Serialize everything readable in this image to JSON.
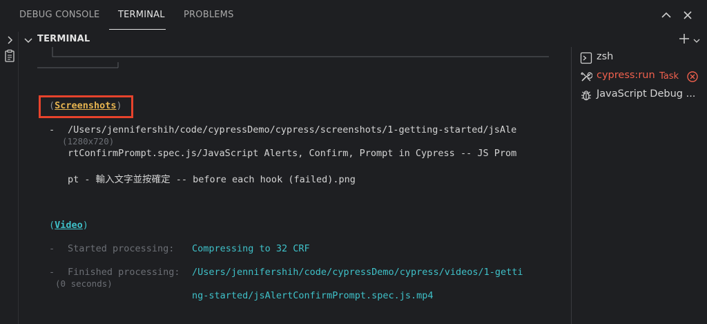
{
  "tabs": {
    "debug_console": "DEBUG CONSOLE",
    "terminal": "TERMINAL",
    "problems": "PROBLEMS"
  },
  "terminal_header": {
    "label": "TERMINAL"
  },
  "terminal_output": {
    "screenshots_heading_open": "(",
    "screenshots_heading_text": "Screenshots",
    "screenshots_heading_close": ")",
    "bullet": "-",
    "screenshot_path_line1": "/Users/jennifershih/code/cypressDemo/cypress/screenshots/1-getting-started/jsAle",
    "screenshot_size": "(1280x720)",
    "screenshot_path_line2": "rtConfirmPrompt.spec.js/JavaScript Alerts, Confirm, Prompt in Cypress -- JS Prom",
    "screenshot_path_line3": "pt - 輸入文字並按確定 -- before each hook (failed).png",
    "video_heading_open": "(",
    "video_heading_text": "Video",
    "video_heading_close": ")",
    "started_label": "Started processing:",
    "started_value": "Compressing to 32 CRF",
    "finished_label": "Finished processing:",
    "finished_value_line1": "/Users/jennifershih/code/cypressDemo/cypress/videos/1-getti",
    "finished_time": "(0 seconds)",
    "finished_value_line2": "ng-started/jsAlertConfirmPrompt.spec.js.mp4"
  },
  "terminal_list": {
    "items": [
      {
        "label": "zsh",
        "icon": "terminal-icon"
      },
      {
        "label": "cypress:run",
        "suffix": "Task",
        "icon": "tools-icon",
        "status_icon": "error-circle-icon"
      },
      {
        "label": "JavaScript Debug ...",
        "icon": "bug-icon"
      }
    ]
  },
  "colors": {
    "background": "#1e1f22",
    "cyan": "#3fc1c9",
    "yellow": "#e6b450",
    "error_red": "#f0604d",
    "highlight_box": "#e7432c"
  }
}
